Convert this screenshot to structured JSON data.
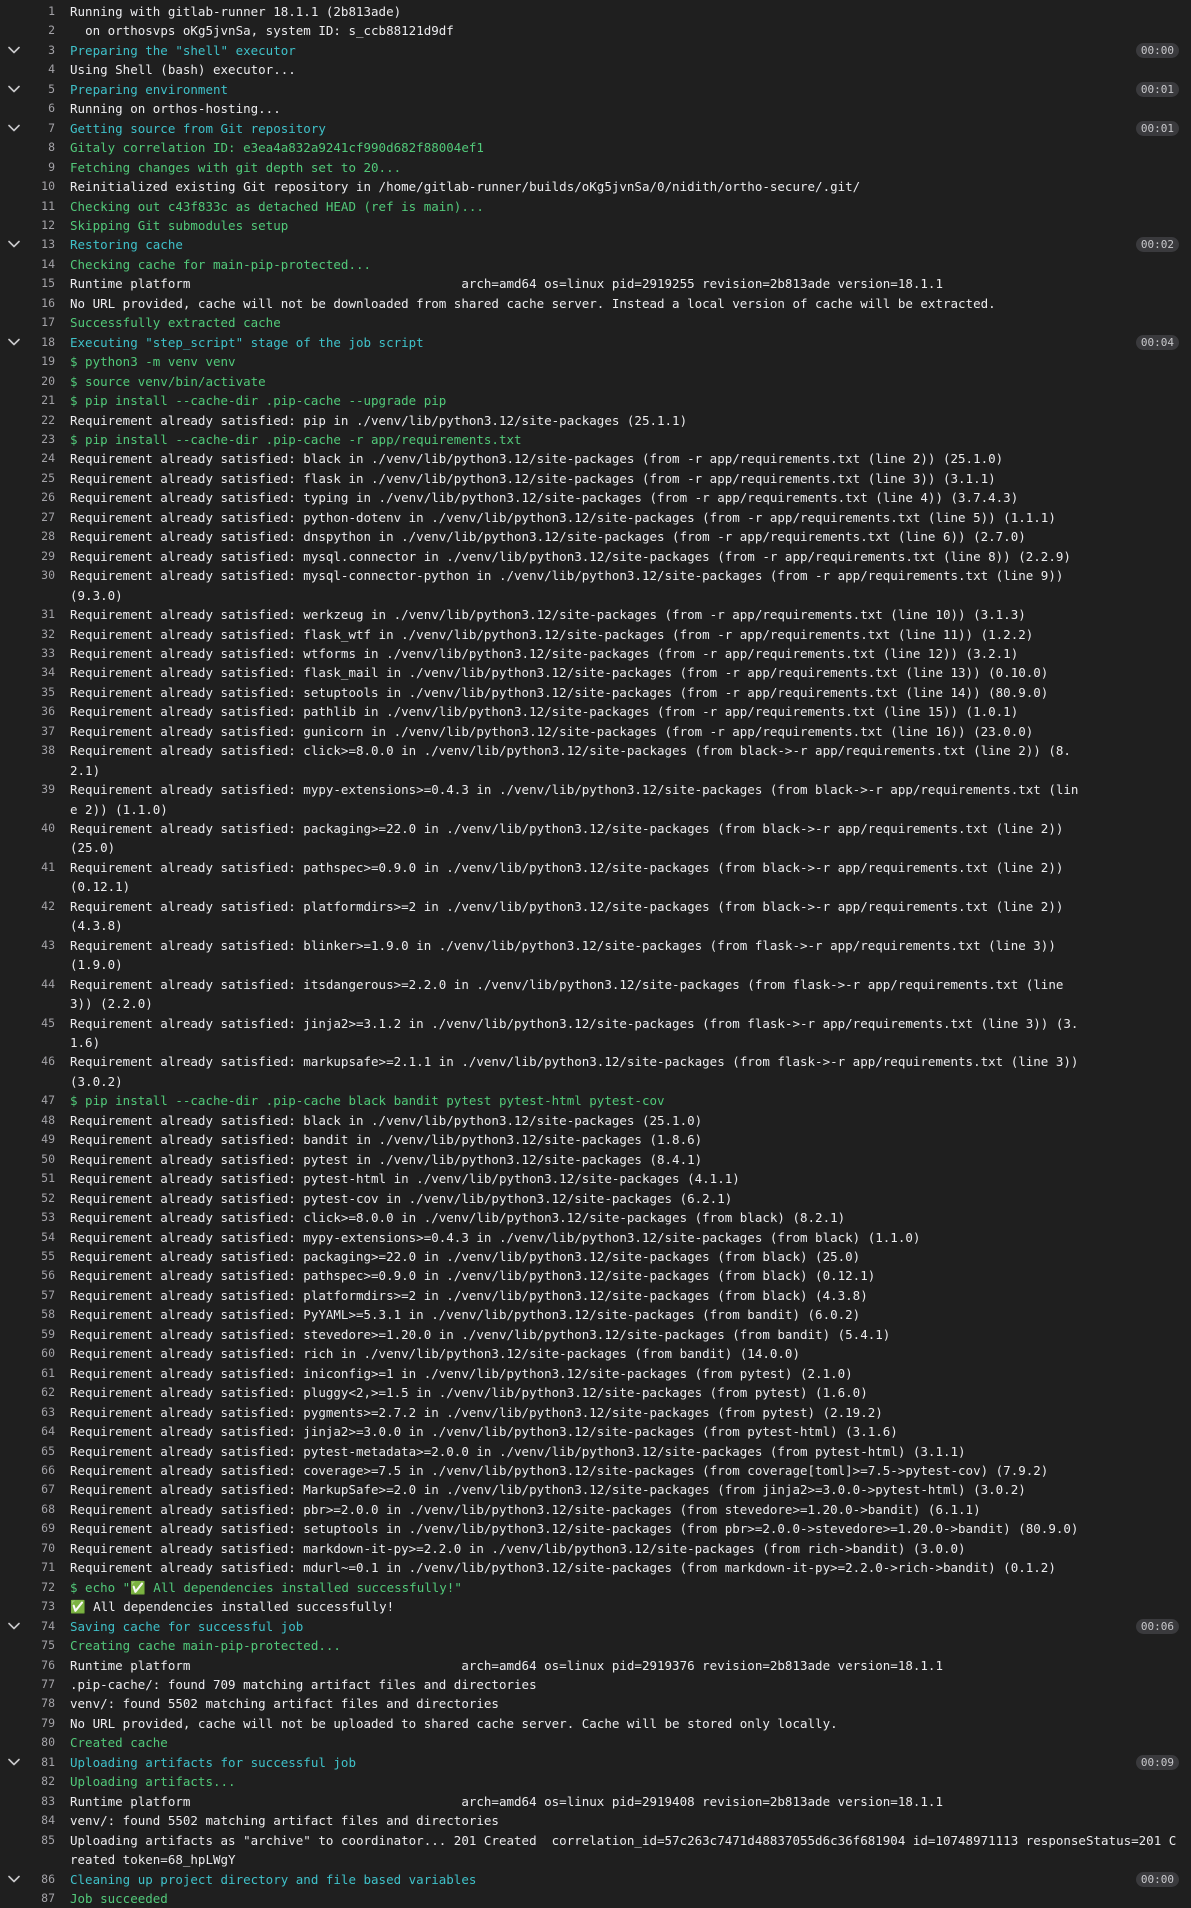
{
  "colors": {
    "background": "#1f1f1f",
    "text": "#ececef",
    "section_header": "#3fc1c9",
    "success": "#52c97a",
    "line_number": "#a4a3a8",
    "duration_badge": "#3a3a3d"
  },
  "log": {
    "lines": [
      {
        "n": "1",
        "text": "Running with gitlab-runner 18.1.1 (2b813ade)",
        "style": "normal"
      },
      {
        "n": "2",
        "text": "  on orthosvps oKg5jvnSa, system ID: s_ccb88121d9df",
        "style": "normal"
      },
      {
        "n": "3",
        "text": "Preparing the \"shell\" executor",
        "style": "section",
        "section": true,
        "duration": "00:00"
      },
      {
        "n": "4",
        "text": "Using Shell (bash) executor...",
        "style": "normal"
      },
      {
        "n": "5",
        "text": "Preparing environment",
        "style": "section",
        "section": true,
        "duration": "00:01"
      },
      {
        "n": "6",
        "text": "Running on orthos-hosting...",
        "style": "normal"
      },
      {
        "n": "7",
        "text": "Getting source from Git repository",
        "style": "section",
        "section": true,
        "duration": "00:01"
      },
      {
        "n": "8",
        "text": "Gitaly correlation ID: e3ea4a832a9241cf990d682f88004ef1",
        "style": "green"
      },
      {
        "n": "9",
        "text": "Fetching changes with git depth set to 20...",
        "style": "green"
      },
      {
        "n": "10",
        "text": "Reinitialized existing Git repository in /home/gitlab-runner/builds/oKg5jvnSa/0/nidith/ortho-secure/.git/",
        "style": "normal"
      },
      {
        "n": "11",
        "text": "Checking out c43f833c as detached HEAD (ref is main)...",
        "style": "green"
      },
      {
        "n": "12",
        "text": "Skipping Git submodules setup",
        "style": "green"
      },
      {
        "n": "13",
        "text": "Restoring cache",
        "style": "section",
        "section": true,
        "duration": "00:02"
      },
      {
        "n": "14",
        "text": "Checking cache for main-pip-protected...",
        "style": "green"
      },
      {
        "n": "15",
        "text": "Runtime platform                                    arch=amd64 os=linux pid=2919255 revision=2b813ade version=18.1.1",
        "style": "normal"
      },
      {
        "n": "16",
        "text": "No URL provided, cache will not be downloaded from shared cache server. Instead a local version of cache will be extracted.",
        "style": "normal"
      },
      {
        "n": "17",
        "text": "Successfully extracted cache",
        "style": "green"
      },
      {
        "n": "18",
        "text": "Executing \"step_script\" stage of the job script",
        "style": "section",
        "section": true,
        "duration": "00:04"
      },
      {
        "n": "19",
        "text": "$ python3 -m venv venv",
        "style": "green"
      },
      {
        "n": "20",
        "text": "$ source venv/bin/activate",
        "style": "green"
      },
      {
        "n": "21",
        "text": "$ pip install --cache-dir .pip-cache --upgrade pip",
        "style": "green"
      },
      {
        "n": "22",
        "text": "Requirement already satisfied: pip in ./venv/lib/python3.12/site-packages (25.1.1)",
        "style": "normal"
      },
      {
        "n": "23",
        "text": "$ pip install --cache-dir .pip-cache -r app/requirements.txt",
        "style": "green"
      },
      {
        "n": "24",
        "text": "Requirement already satisfied: black in ./venv/lib/python3.12/site-packages (from -r app/requirements.txt (line 2)) (25.1.0)",
        "style": "normal"
      },
      {
        "n": "25",
        "text": "Requirement already satisfied: flask in ./venv/lib/python3.12/site-packages (from -r app/requirements.txt (line 3)) (3.1.1)",
        "style": "normal"
      },
      {
        "n": "26",
        "text": "Requirement already satisfied: typing in ./venv/lib/python3.12/site-packages (from -r app/requirements.txt (line 4)) (3.7.4.3)",
        "style": "normal"
      },
      {
        "n": "27",
        "text": "Requirement already satisfied: python-dotenv in ./venv/lib/python3.12/site-packages (from -r app/requirements.txt (line 5)) (1.1.1)",
        "style": "normal"
      },
      {
        "n": "28",
        "text": "Requirement already satisfied: dnspython in ./venv/lib/python3.12/site-packages (from -r app/requirements.txt (line 6)) (2.7.0)",
        "style": "normal"
      },
      {
        "n": "29",
        "text": "Requirement already satisfied: mysql.connector in ./venv/lib/python3.12/site-packages (from -r app/requirements.txt (line 8)) (2.2.9)",
        "style": "normal"
      },
      {
        "n": "30",
        "text": "Requirement already satisfied: mysql-connector-python in ./venv/lib/python3.12/site-packages (from -r app/requirements.txt (line 9)) (9.3.0)",
        "style": "normal"
      },
      {
        "n": "31",
        "text": "Requirement already satisfied: werkzeug in ./venv/lib/python3.12/site-packages (from -r app/requirements.txt (line 10)) (3.1.3)",
        "style": "normal"
      },
      {
        "n": "32",
        "text": "Requirement already satisfied: flask_wtf in ./venv/lib/python3.12/site-packages (from -r app/requirements.txt (line 11)) (1.2.2)",
        "style": "normal"
      },
      {
        "n": "33",
        "text": "Requirement already satisfied: wtforms in ./venv/lib/python3.12/site-packages (from -r app/requirements.txt (line 12)) (3.2.1)",
        "style": "normal"
      },
      {
        "n": "34",
        "text": "Requirement already satisfied: flask_mail in ./venv/lib/python3.12/site-packages (from -r app/requirements.txt (line 13)) (0.10.0)",
        "style": "normal"
      },
      {
        "n": "35",
        "text": "Requirement already satisfied: setuptools in ./venv/lib/python3.12/site-packages (from -r app/requirements.txt (line 14)) (80.9.0)",
        "style": "normal"
      },
      {
        "n": "36",
        "text": "Requirement already satisfied: pathlib in ./venv/lib/python3.12/site-packages (from -r app/requirements.txt (line 15)) (1.0.1)",
        "style": "normal"
      },
      {
        "n": "37",
        "text": "Requirement already satisfied: gunicorn in ./venv/lib/python3.12/site-packages (from -r app/requirements.txt (line 16)) (23.0.0)",
        "style": "normal"
      },
      {
        "n": "38",
        "text": "Requirement already satisfied: click>=8.0.0 in ./venv/lib/python3.12/site-packages (from black->-r app/requirements.txt (line 2)) (8.2.1)",
        "style": "normal"
      },
      {
        "n": "39",
        "text": "Requirement already satisfied: mypy-extensions>=0.4.3 in ./venv/lib/python3.12/site-packages (from black->-r app/requirements.txt (line 2)) (1.1.0)",
        "style": "normal"
      },
      {
        "n": "40",
        "text": "Requirement already satisfied: packaging>=22.0 in ./venv/lib/python3.12/site-packages (from black->-r app/requirements.txt (line 2)) (25.0)",
        "style": "normal"
      },
      {
        "n": "41",
        "text": "Requirement already satisfied: pathspec>=0.9.0 in ./venv/lib/python3.12/site-packages (from black->-r app/requirements.txt (line 2)) (0.12.1)",
        "style": "normal"
      },
      {
        "n": "42",
        "text": "Requirement already satisfied: platformdirs>=2 in ./venv/lib/python3.12/site-packages (from black->-r app/requirements.txt (line 2)) (4.3.8)",
        "style": "normal"
      },
      {
        "n": "43",
        "text": "Requirement already satisfied: blinker>=1.9.0 in ./venv/lib/python3.12/site-packages (from flask->-r app/requirements.txt (line 3)) (1.9.0)",
        "style": "normal"
      },
      {
        "n": "44",
        "text": "Requirement already satisfied: itsdangerous>=2.2.0 in ./venv/lib/python3.12/site-packages (from flask->-r app/requirements.txt (line 3)) (2.2.0)",
        "style": "normal"
      },
      {
        "n": "45",
        "text": "Requirement already satisfied: jinja2>=3.1.2 in ./venv/lib/python3.12/site-packages (from flask->-r app/requirements.txt (line 3)) (3.1.6)",
        "style": "normal"
      },
      {
        "n": "46",
        "text": "Requirement already satisfied: markupsafe>=2.1.1 in ./venv/lib/python3.12/site-packages (from flask->-r app/requirements.txt (line 3)) (3.0.2)",
        "style": "normal"
      },
      {
        "n": "47",
        "text": "$ pip install --cache-dir .pip-cache black bandit pytest pytest-html pytest-cov",
        "style": "green"
      },
      {
        "n": "48",
        "text": "Requirement already satisfied: black in ./venv/lib/python3.12/site-packages (25.1.0)",
        "style": "normal"
      },
      {
        "n": "49",
        "text": "Requirement already satisfied: bandit in ./venv/lib/python3.12/site-packages (1.8.6)",
        "style": "normal"
      },
      {
        "n": "50",
        "text": "Requirement already satisfied: pytest in ./venv/lib/python3.12/site-packages (8.4.1)",
        "style": "normal"
      },
      {
        "n": "51",
        "text": "Requirement already satisfied: pytest-html in ./venv/lib/python3.12/site-packages (4.1.1)",
        "style": "normal"
      },
      {
        "n": "52",
        "text": "Requirement already satisfied: pytest-cov in ./venv/lib/python3.12/site-packages (6.2.1)",
        "style": "normal"
      },
      {
        "n": "53",
        "text": "Requirement already satisfied: click>=8.0.0 in ./venv/lib/python3.12/site-packages (from black) (8.2.1)",
        "style": "normal"
      },
      {
        "n": "54",
        "text": "Requirement already satisfied: mypy-extensions>=0.4.3 in ./venv/lib/python3.12/site-packages (from black) (1.1.0)",
        "style": "normal"
      },
      {
        "n": "55",
        "text": "Requirement already satisfied: packaging>=22.0 in ./venv/lib/python3.12/site-packages (from black) (25.0)",
        "style": "normal"
      },
      {
        "n": "56",
        "text": "Requirement already satisfied: pathspec>=0.9.0 in ./venv/lib/python3.12/site-packages (from black) (0.12.1)",
        "style": "normal"
      },
      {
        "n": "57",
        "text": "Requirement already satisfied: platformdirs>=2 in ./venv/lib/python3.12/site-packages (from black) (4.3.8)",
        "style": "normal"
      },
      {
        "n": "58",
        "text": "Requirement already satisfied: PyYAML>=5.3.1 in ./venv/lib/python3.12/site-packages (from bandit) (6.0.2)",
        "style": "normal"
      },
      {
        "n": "59",
        "text": "Requirement already satisfied: stevedore>=1.20.0 in ./venv/lib/python3.12/site-packages (from bandit) (5.4.1)",
        "style": "normal"
      },
      {
        "n": "60",
        "text": "Requirement already satisfied: rich in ./venv/lib/python3.12/site-packages (from bandit) (14.0.0)",
        "style": "normal"
      },
      {
        "n": "61",
        "text": "Requirement already satisfied: iniconfig>=1 in ./venv/lib/python3.12/site-packages (from pytest) (2.1.0)",
        "style": "normal"
      },
      {
        "n": "62",
        "text": "Requirement already satisfied: pluggy<2,>=1.5 in ./venv/lib/python3.12/site-packages (from pytest) (1.6.0)",
        "style": "normal"
      },
      {
        "n": "63",
        "text": "Requirement already satisfied: pygments>=2.7.2 in ./venv/lib/python3.12/site-packages (from pytest) (2.19.2)",
        "style": "normal"
      },
      {
        "n": "64",
        "text": "Requirement already satisfied: jinja2>=3.0.0 in ./venv/lib/python3.12/site-packages (from pytest-html) (3.1.6)",
        "style": "normal"
      },
      {
        "n": "65",
        "text": "Requirement already satisfied: pytest-metadata>=2.0.0 in ./venv/lib/python3.12/site-packages (from pytest-html) (3.1.1)",
        "style": "normal"
      },
      {
        "n": "66",
        "text": "Requirement already satisfied: coverage>=7.5 in ./venv/lib/python3.12/site-packages (from coverage[toml]>=7.5->pytest-cov) (7.9.2)",
        "style": "normal"
      },
      {
        "n": "67",
        "text": "Requirement already satisfied: MarkupSafe>=2.0 in ./venv/lib/python3.12/site-packages (from jinja2>=3.0.0->pytest-html) (3.0.2)",
        "style": "normal"
      },
      {
        "n": "68",
        "text": "Requirement already satisfied: pbr>=2.0.0 in ./venv/lib/python3.12/site-packages (from stevedore>=1.20.0->bandit) (6.1.1)",
        "style": "normal"
      },
      {
        "n": "69",
        "text": "Requirement already satisfied: setuptools in ./venv/lib/python3.12/site-packages (from pbr>=2.0.0->stevedore>=1.20.0->bandit) (80.9.0)",
        "style": "normal"
      },
      {
        "n": "70",
        "text": "Requirement already satisfied: markdown-it-py>=2.2.0 in ./venv/lib/python3.12/site-packages (from rich->bandit) (3.0.0)",
        "style": "normal"
      },
      {
        "n": "71",
        "text": "Requirement already satisfied: mdurl~=0.1 in ./venv/lib/python3.12/site-packages (from markdown-it-py>=2.2.0->rich->bandit) (0.1.2)",
        "style": "normal"
      },
      {
        "n": "72",
        "text": "$ echo \"✅ All dependencies installed successfully!\"",
        "style": "green"
      },
      {
        "n": "73",
        "text": "✅ All dependencies installed successfully!",
        "style": "normal"
      },
      {
        "n": "74",
        "text": "Saving cache for successful job",
        "style": "section",
        "section": true,
        "duration": "00:06"
      },
      {
        "n": "75",
        "text": "Creating cache main-pip-protected...",
        "style": "green"
      },
      {
        "n": "76",
        "text": "Runtime platform                                    arch=amd64 os=linux pid=2919376 revision=2b813ade version=18.1.1",
        "style": "normal"
      },
      {
        "n": "77",
        "text": ".pip-cache/: found 709 matching artifact files and directories",
        "style": "normal"
      },
      {
        "n": "78",
        "text": "venv/: found 5502 matching artifact files and directories",
        "style": "normal"
      },
      {
        "n": "79",
        "text": "No URL provided, cache will not be uploaded to shared cache server. Cache will be stored only locally.",
        "style": "normal"
      },
      {
        "n": "80",
        "text": "Created cache",
        "style": "green"
      },
      {
        "n": "81",
        "text": "Uploading artifacts for successful job",
        "style": "section",
        "section": true,
        "duration": "00:09"
      },
      {
        "n": "82",
        "text": "Uploading artifacts...",
        "style": "green"
      },
      {
        "n": "83",
        "text": "Runtime platform                                    arch=amd64 os=linux pid=2919408 revision=2b813ade version=18.1.1",
        "style": "normal"
      },
      {
        "n": "84",
        "text": "venv/: found 5502 matching artifact files and directories",
        "style": "normal"
      },
      {
        "n": "85",
        "text": "Uploading artifacts as \"archive\" to coordinator... 201 Created  correlation_id=57c263c7471d48837055d6c36f681904 id=10748971113 responseStatus=201 Created token=68_hpLWgY",
        "style": "normal",
        "wrap": true
      },
      {
        "n": "86",
        "text": "Cleaning up project directory and file based variables",
        "style": "section",
        "section": true,
        "duration": "00:00"
      },
      {
        "n": "87",
        "text": "Job succeeded",
        "style": "green"
      }
    ]
  }
}
